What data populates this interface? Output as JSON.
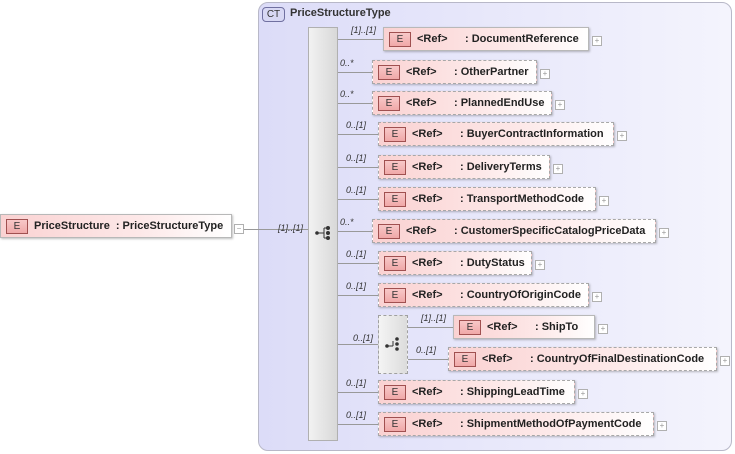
{
  "root": {
    "badge": "E",
    "name": "PriceStructure",
    "type": ": PriceStructureType",
    "collapse": "−",
    "multiplicity": "[1]..[1]"
  },
  "complex_type": {
    "badge": "CT",
    "name": "PriceStructureType"
  },
  "children": [
    {
      "badge": "E",
      "ref": "<Ref>",
      "name": ": DocumentReference",
      "multiplicity": "[1]..[1]",
      "optional": false
    },
    {
      "badge": "E",
      "ref": "<Ref>",
      "name": ": OtherPartner",
      "multiplicity": "0..*",
      "optional": true
    },
    {
      "badge": "E",
      "ref": "<Ref>",
      "name": ": PlannedEndUse",
      "multiplicity": "0..*",
      "optional": true
    },
    {
      "badge": "E",
      "ref": "<Ref>",
      "name": ": BuyerContractInformation",
      "multiplicity": "0..[1]",
      "optional": true
    },
    {
      "badge": "E",
      "ref": "<Ref>",
      "name": ": DeliveryTerms",
      "multiplicity": "0..[1]",
      "optional": true
    },
    {
      "badge": "E",
      "ref": "<Ref>",
      "name": ": TransportMethodCode",
      "multiplicity": "0..[1]",
      "optional": true
    },
    {
      "badge": "E",
      "ref": "<Ref>",
      "name": ": CustomerSpecificCatalogPriceData",
      "multiplicity": "0..*",
      "optional": true
    },
    {
      "badge": "E",
      "ref": "<Ref>",
      "name": ": DutyStatus",
      "multiplicity": "0..[1]",
      "optional": true
    },
    {
      "badge": "E",
      "ref": "<Ref>",
      "name": ": CountryOfOriginCode",
      "multiplicity": "0..[1]",
      "optional": true
    },
    {
      "badge": "E",
      "ref": "<Ref>",
      "name": ": ShippingLeadTime",
      "multiplicity": "0..[1]",
      "optional": true
    },
    {
      "badge": "E",
      "ref": "<Ref>",
      "name": ": ShipmentMethodOfPaymentCode",
      "multiplicity": "0..[1]",
      "optional": true
    }
  ],
  "choice": {
    "multiplicity": "0..[1]",
    "children": [
      {
        "badge": "E",
        "ref": "<Ref>",
        "name": ": ShipTo",
        "multiplicity": "[1]..[1]",
        "optional": false
      },
      {
        "badge": "E",
        "ref": "<Ref>",
        "name": ": CountryOfFinalDestinationCode",
        "multiplicity": "0..[1]",
        "optional": true
      }
    ]
  },
  "expand_symbol": "+"
}
